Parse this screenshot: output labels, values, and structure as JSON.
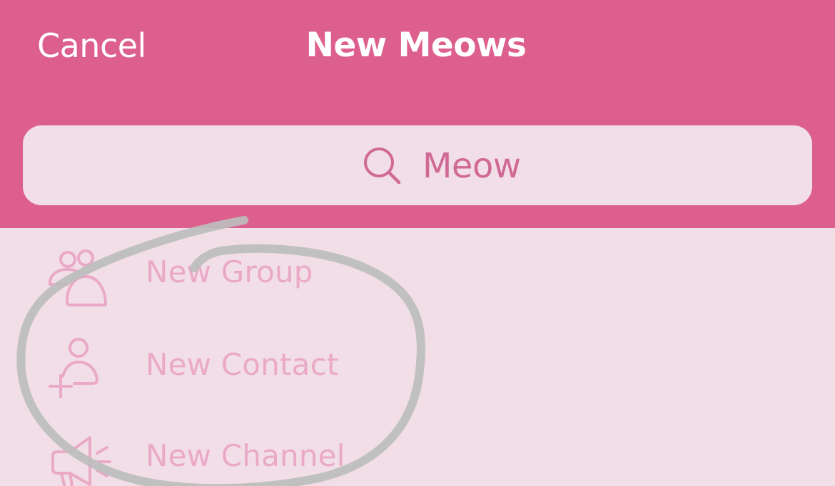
{
  "header": {
    "cancel_label": "Cancel",
    "title": "New Meows"
  },
  "search": {
    "placeholder": "Meow",
    "icon": "search-icon"
  },
  "menu": {
    "items": [
      {
        "label": "New Group",
        "icon": "group-icon"
      },
      {
        "label": "New Contact",
        "icon": "add-contact-icon"
      },
      {
        "label": "New Channel",
        "icon": "megaphone-icon"
      }
    ]
  },
  "annotation": {
    "type": "hand-drawn circle",
    "color": "#bdbdbd"
  },
  "colors": {
    "header_bg": "#dd5f8d",
    "body_bg": "#f2dee6",
    "accent": "#d06a95",
    "menu_text": "#eaa9c6"
  }
}
